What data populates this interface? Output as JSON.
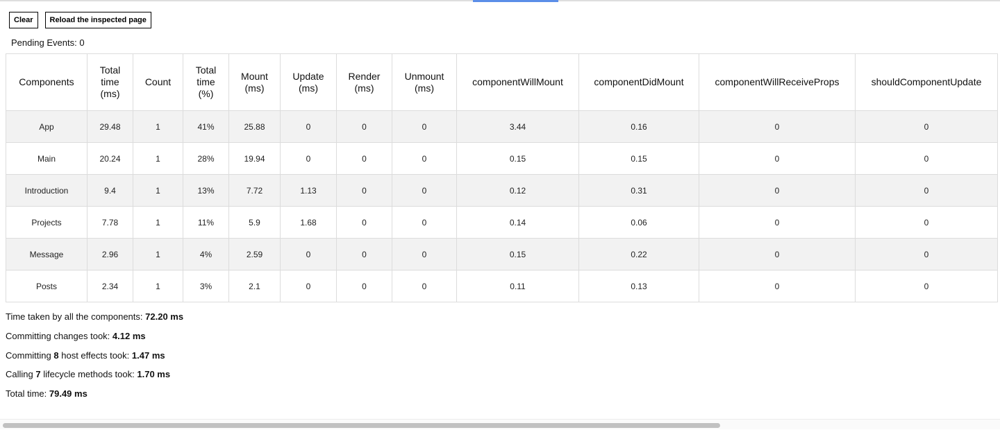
{
  "toolbar": {
    "clear_label": "Clear",
    "reload_label": "Reload the inspected page"
  },
  "pending": {
    "label": "Pending Events:",
    "count": "0"
  },
  "table": {
    "headers": [
      [
        "Components"
      ],
      [
        "Total",
        "time",
        "(ms)"
      ],
      [
        "Count"
      ],
      [
        "Total",
        "time",
        "(%)"
      ],
      [
        "Mount",
        "(ms)"
      ],
      [
        "Update",
        "(ms)"
      ],
      [
        "Render",
        "(ms)"
      ],
      [
        "Unmount",
        "(ms)"
      ],
      [
        "componentWillMount"
      ],
      [
        "componentDidMount"
      ],
      [
        "componentWillReceiveProps"
      ],
      [
        "shouldComponentUpdate"
      ]
    ],
    "rows": [
      [
        "App",
        "29.48",
        "1",
        "41%",
        "25.88",
        "0",
        "0",
        "0",
        "3.44",
        "0.16",
        "0",
        "0"
      ],
      [
        "Main",
        "20.24",
        "1",
        "28%",
        "19.94",
        "0",
        "0",
        "0",
        "0.15",
        "0.15",
        "0",
        "0"
      ],
      [
        "Introduction",
        "9.4",
        "1",
        "13%",
        "7.72",
        "1.13",
        "0",
        "0",
        "0.12",
        "0.31",
        "0",
        "0"
      ],
      [
        "Projects",
        "7.78",
        "1",
        "11%",
        "5.9",
        "1.68",
        "0",
        "0",
        "0.14",
        "0.06",
        "0",
        "0"
      ],
      [
        "Message",
        "2.96",
        "1",
        "4%",
        "2.59",
        "0",
        "0",
        "0",
        "0.15",
        "0.22",
        "0",
        "0"
      ],
      [
        "Posts",
        "2.34",
        "1",
        "3%",
        "2.1",
        "0",
        "0",
        "0",
        "0.11",
        "0.13",
        "0",
        "0"
      ]
    ]
  },
  "summary": {
    "components_label": "Time taken by all the components:",
    "components_value": "72.20 ms",
    "commit_label": "Committing changes took:",
    "commit_value": "4.12 ms",
    "host_prefix": "Committing",
    "host_count": "8",
    "host_suffix": "host effects took:",
    "host_value": "1.47 ms",
    "lifecycle_prefix": "Calling",
    "lifecycle_count": "7",
    "lifecycle_suffix": "lifecycle methods took:",
    "lifecycle_value": "1.70 ms",
    "total_label": "Total time:",
    "total_value": "79.49 ms"
  }
}
